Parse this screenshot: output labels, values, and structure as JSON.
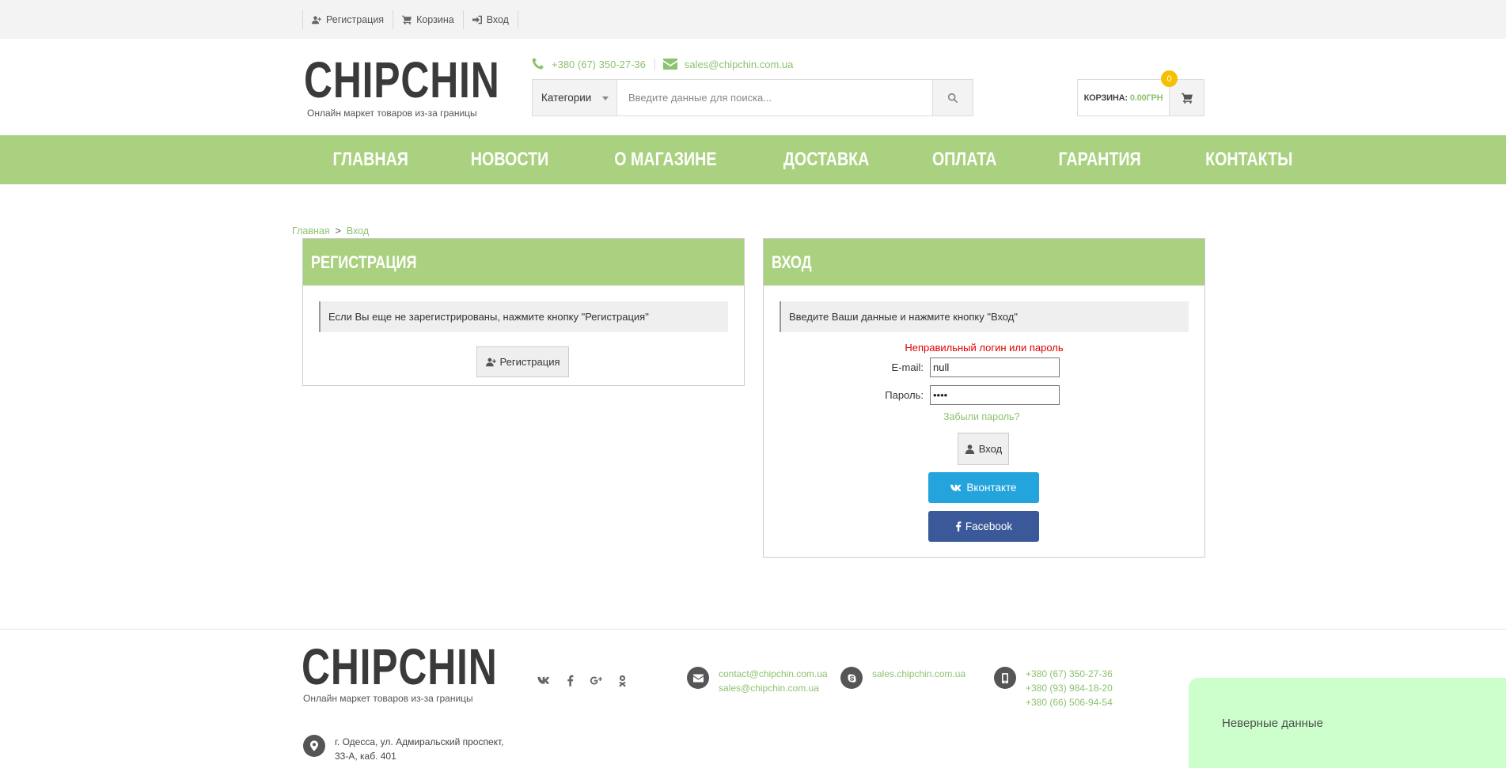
{
  "topbar": {
    "links": [
      {
        "label": "Регистрация",
        "icon": "user-plus-icon"
      },
      {
        "label": "Корзина",
        "icon": "cart-icon"
      },
      {
        "label": "Вход",
        "icon": "sign-in-icon"
      }
    ]
  },
  "header": {
    "logo": "CHIPCHIN",
    "tagline": "Онлайн маркет товаров из-за границы",
    "phone": "+380 (67) 350-27-36",
    "email": "sales@chipchin.com.ua",
    "search": {
      "category": "Категории",
      "placeholder": "Введите данные для поиска...",
      "value": ""
    },
    "cart": {
      "label": "КОРЗИНА:",
      "amount": "0.00ГРН",
      "count": "0"
    }
  },
  "nav": {
    "items": [
      "ГЛАВНАЯ",
      "НОВОСТИ",
      "О МАГАЗИНЕ",
      "ДОСТАВКА",
      "ОПЛАТА",
      "ГАРАНТИЯ",
      "КОНТАКТЫ"
    ]
  },
  "breadcrumb": {
    "home": "Главная",
    "separator": ">",
    "current": "Вход"
  },
  "register_panel": {
    "title": "РЕГИСТРАЦИЯ",
    "note": "Если Вы еще не зарегистрированы, нажмите кнопку \"Регистрация\"",
    "button": "Регистрация"
  },
  "login_panel": {
    "title": "ВХОД",
    "note": "Введите Ваши данные и нажмите кнопку \"Вход\"",
    "error": "Неправильный логин или пароль",
    "email_label": "E-mail:",
    "email_value": "null",
    "password_label": "Пароль:",
    "password_value": "••••",
    "forgot": "Забыли пароль?",
    "submit": "Вход",
    "vk": "Вконтакте",
    "facebook": "Facebook"
  },
  "footer": {
    "logo": "CHIPCHIN",
    "tagline": "Онлайн маркет товаров из-за границы",
    "social": [
      "vk-icon",
      "facebook-icon",
      "google-plus-icon",
      "odnoklassniki-icon"
    ],
    "emails": [
      "contact@chipchin.com.ua",
      "sales@chipchin.com.ua"
    ],
    "skype": "sales.chipchin.com.ua",
    "phones": [
      "+380 (67) 350-27-36",
      "+380 (93) 984-18-20",
      "+380 (66) 506-94-54"
    ],
    "address": [
      "г. Одесса, ул. Адмиральский проспект,",
      "33-А, каб. 401"
    ]
  },
  "toast": {
    "message": "Неверные данные"
  },
  "colors": {
    "accent_green": "#a9d17f",
    "link_green": "#8dc26e",
    "error_red": "#e00000",
    "vk_blue": "#24a4dc",
    "facebook_blue": "#3b5998",
    "badge_yellow": "#f4c000",
    "toast_bg": "#ccffcc"
  }
}
